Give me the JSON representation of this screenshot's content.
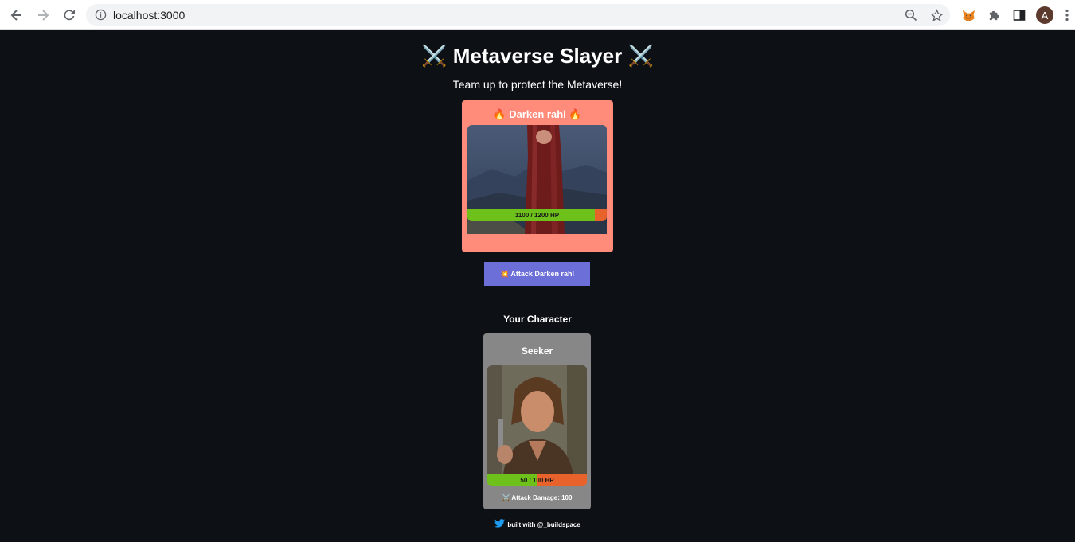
{
  "browser": {
    "url": "localhost:3000",
    "avatar_letter": "A"
  },
  "header": {
    "title": "⚔️ Metaverse Slayer ⚔️",
    "subtitle": "Team up to protect the Metaverse!"
  },
  "boss": {
    "name": "🔥 Darken rahl 🔥",
    "hp_text": "1100 / 1200 HP",
    "hp": 1100,
    "max_hp": 1200,
    "card_color": "#ff8b7a"
  },
  "attack_button": {
    "label": "💥 Attack Darken rahl",
    "color": "#6d6fd8"
  },
  "player": {
    "section_label": "Your Character",
    "name": "Seeker",
    "hp_text": "50 / 100 HP",
    "hp": 50,
    "max_hp": 100,
    "attack_damage": "⚔️ Attack Damage: 100",
    "card_color": "#878787"
  },
  "footer": {
    "link_text": "built with @_buildspace",
    "icon": "twitter-icon"
  },
  "colors": {
    "background": "#0d1116",
    "hp_fill": "#6dc11a",
    "hp_empty": "#e8632b"
  }
}
